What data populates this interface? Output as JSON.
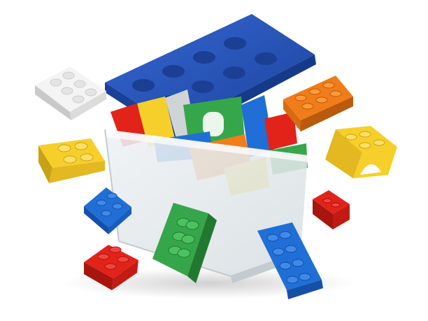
{
  "scene": {
    "subject": "",
    "colors": {
      "background": "#ffffff",
      "blue": "#1f6fd6",
      "blue_dark": "#164fa8",
      "red": "#e2231a",
      "red_dark": "#a8140e",
      "yellow": "#f7cf2a",
      "yellow_dark": "#c9a114",
      "green": "#36a64a",
      "green_dark": "#21782f",
      "orange": "#f07d1a",
      "orange_dark": "#b95a0c",
      "white": "#f4f4f4",
      "white_dark": "#c9c9c9",
      "box": "#e6ecef",
      "box_edge": "#c2cbd0",
      "lid": "#2352b8",
      "lid_dark": "#163a8a"
    }
  }
}
